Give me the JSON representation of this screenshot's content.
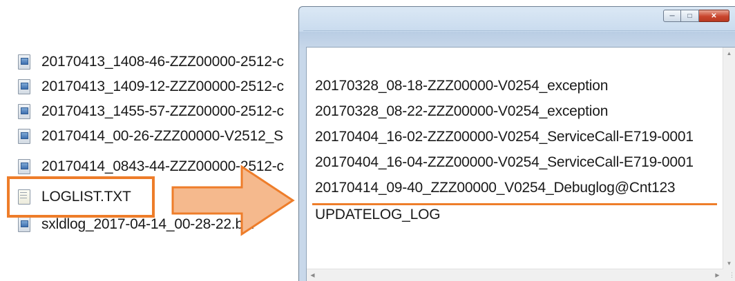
{
  "files": [
    {
      "name": "20170413_1408-46-ZZZ00000-2512-c",
      "icon": "binary-file-icon"
    },
    {
      "name": "20170413_1409-12-ZZZ00000-2512-c",
      "icon": "binary-file-icon"
    },
    {
      "name": "20170413_1455-57-ZZZ00000-2512-c",
      "icon": "binary-file-icon"
    },
    {
      "name": "20170414_00-26-ZZZ00000-V2512_S",
      "icon": "binary-file-icon"
    },
    {
      "name": "20170414_0843-44-ZZZ00000-2512-c",
      "icon": "binary-file-icon"
    },
    {
      "name": "LOGLIST.TXT",
      "icon": "text-file-icon"
    },
    {
      "name": "sxldlog_2017-04-14_00-28-22.bin",
      "icon": "binary-file-icon"
    }
  ],
  "window": {
    "lines": [
      "20170328_08-18-ZZZ00000-V0254_exception",
      "20170328_08-22-ZZZ00000-V0254_exception",
      "20170404_16-02-ZZZ00000-V0254_ServiceCall-E719-0001",
      "20170404_16-04-ZZZ00000-V0254_ServiceCall-E719-0001",
      "20170414_09-40_ZZZ00000_V0254_Debuglog@Cnt123",
      "UPDATELOG_LOG"
    ]
  },
  "colors": {
    "accent": "#ee7d2a",
    "arrow_fill": "#f5b98d"
  }
}
